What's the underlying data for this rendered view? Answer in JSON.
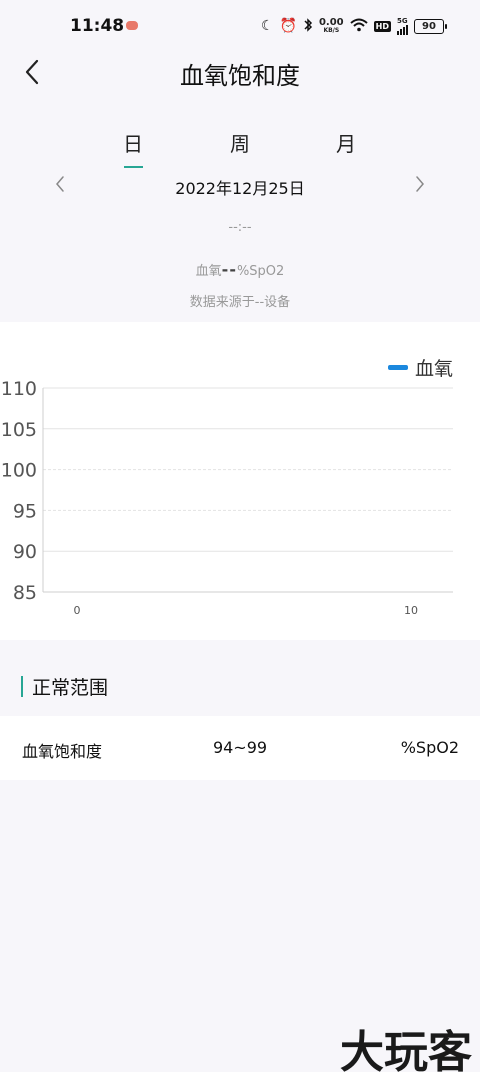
{
  "status_bar": {
    "time": "11:48",
    "net_speed_value": "0.00",
    "net_speed_unit": "KB/S",
    "hd": "HD",
    "network": "5G",
    "battery": "90"
  },
  "header": {
    "title": "血氧饱和度"
  },
  "tabs": [
    {
      "label": "日",
      "active": true
    },
    {
      "label": "周",
      "active": false
    },
    {
      "label": "月",
      "active": false
    }
  ],
  "date_nav": {
    "date": "2022年12月25日"
  },
  "reading": {
    "time": "--:--",
    "prefix": "血氧",
    "value": "--",
    "unit": "%SpO2",
    "source": "数据来源于--设备"
  },
  "chart_data": {
    "type": "line",
    "series": [
      {
        "name": "血氧",
        "values": []
      }
    ],
    "x": [],
    "xlim": [
      0,
      10
    ],
    "xticks": [
      "0",
      "10"
    ],
    "ylim": [
      85,
      110
    ],
    "yticks": [
      "85",
      "90",
      "95",
      "100",
      "105",
      "110"
    ],
    "grid": true,
    "legend": "top-right",
    "colors": {
      "series": "#1b88de",
      "grid": "#e3e3e3"
    }
  },
  "normal_range": {
    "title": "正常范围",
    "name": "血氧饱和度",
    "value": "94~99",
    "unit": "%SpO2"
  },
  "watermark": "大玩客",
  "colors": {
    "accent": "#27a694",
    "background": "#f7f6fa",
    "card": "#ffffff"
  }
}
